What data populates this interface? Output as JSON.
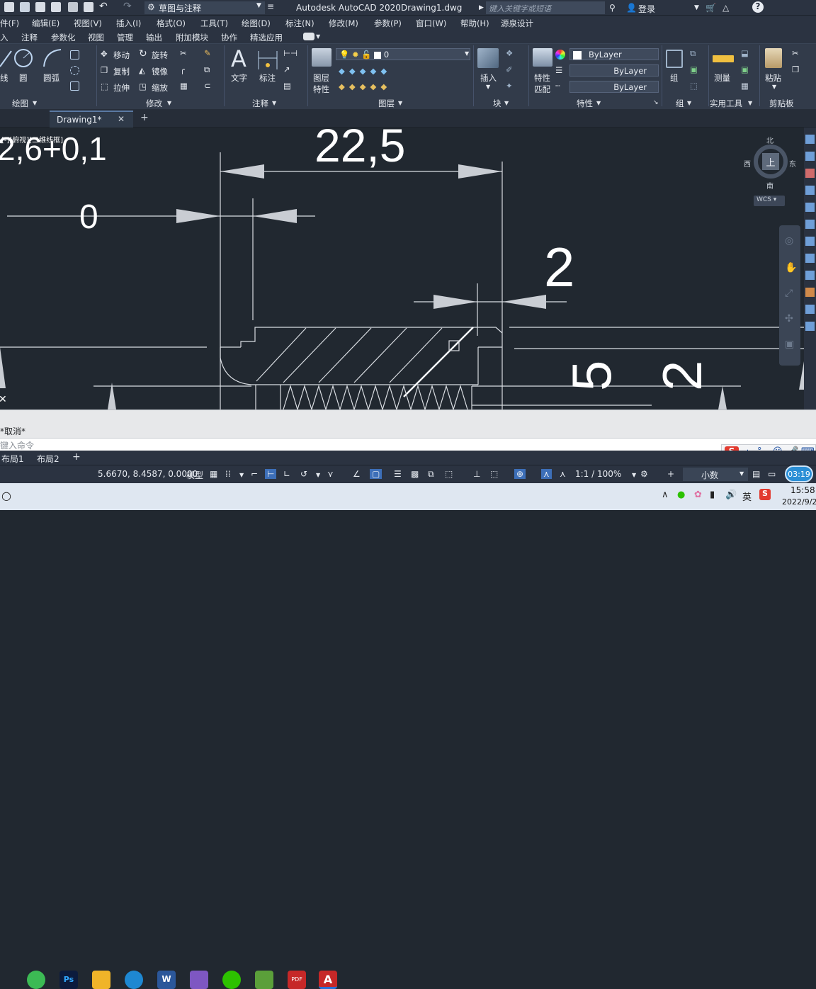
{
  "titlebar": {
    "workspace": "草图与注释",
    "app_title": "Autodesk AutoCAD 2020",
    "file_name": "Drawing1.dwg",
    "search_placeholder": "键入关键字或短语",
    "login": "登录"
  },
  "menus": [
    "件(F)",
    "编辑(E)",
    "视图(V)",
    "插入(I)",
    "格式(O)",
    "工具(T)",
    "绘图(D)",
    "标注(N)",
    "修改(M)",
    "参数(P)",
    "窗口(W)",
    "帮助(H)",
    "源泉设计"
  ],
  "ribbon_tabs": [
    "入",
    "注释",
    "参数化",
    "视图",
    "管理",
    "输出",
    "附加模块",
    "协作",
    "精选应用"
  ],
  "ribbon": {
    "draw": {
      "title": "绘图",
      "line": "线",
      "circle": "圆",
      "arc": "圆弧"
    },
    "modify": {
      "title": "修改",
      "move": "移动",
      "rotate": "旋转",
      "copy": "复制",
      "mirror": "镜像",
      "stretch": "拉伸",
      "scale": "缩放"
    },
    "annotation": {
      "title": "注释",
      "text": "文字",
      "dimension": "标注"
    },
    "layers": {
      "title": "图层",
      "props_line1": "图层",
      "props_line2": "特性",
      "current_layer": "0"
    },
    "block": {
      "title": "块",
      "insert": "插入"
    },
    "properties": {
      "title": "特性",
      "match_line1": "特性",
      "match_line2": "匹配",
      "color": "ByLayer",
      "linetype": "ByLayer",
      "lineweight": "ByLayer"
    },
    "groups": {
      "title": "组",
      "group": "组"
    },
    "utilities": {
      "title": "实用工具",
      "measure": "测量"
    },
    "clipboard": {
      "title": "剪贴板",
      "paste": "粘贴"
    }
  },
  "doc_tab": {
    "name": "Drawing1*"
  },
  "drawing": {
    "viewport_label": "[-][俯视][二维线框]",
    "dims": [
      "2,6+0,1",
      "22,5",
      "0",
      "2",
      "5",
      "2"
    ]
  },
  "viewcube": {
    "north": "北",
    "south": "南",
    "east": "东",
    "west": "西",
    "face": "上",
    "wcs": "WCS"
  },
  "command": {
    "history": "*取消*",
    "placeholder": "键入命令"
  },
  "layout_tabs": [
    "布局1",
    "布局2"
  ],
  "status": {
    "coords": "5.6670, 8.4587, 0.0000",
    "model": "模型",
    "scale": "1:1 / 100%",
    "units": "小数"
  },
  "ime": {
    "lang": "中",
    "time": "03:19"
  },
  "taskbar": {
    "time": "15:58",
    "date": "2022/9/2",
    "ime_lang": "英"
  }
}
